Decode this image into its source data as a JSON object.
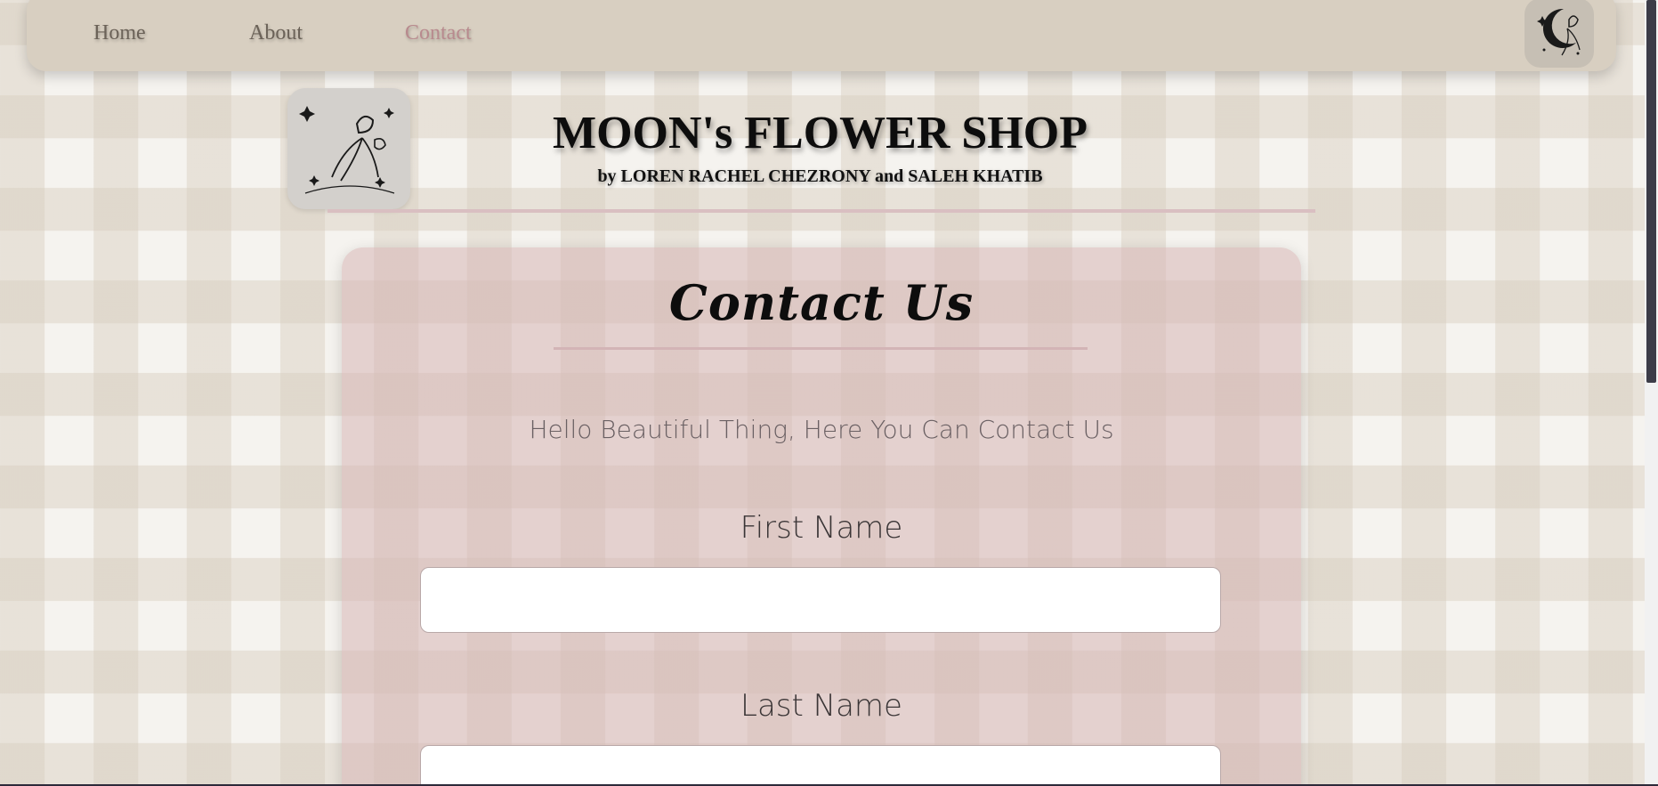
{
  "nav": {
    "items": [
      {
        "label": "Home",
        "active": false
      },
      {
        "label": "About",
        "active": false
      },
      {
        "label": "Contact",
        "active": true
      }
    ],
    "logo_icon": "moon-flower-logo-icon"
  },
  "header": {
    "title": "MOON's FLOWER SHOP",
    "subtitle": "by LOREN RACHEL CHEZRONY and SALEH KHATIB",
    "logo_icon": "moon-flower-logo-icon"
  },
  "contact": {
    "title": "Contact Us",
    "intro": "Hello Beautiful Thing, Here You Can Contact Us",
    "fields": [
      {
        "label": "First Name",
        "value": ""
      },
      {
        "label": "Last Name",
        "value": ""
      }
    ]
  },
  "colors": {
    "nav_bg": "#d8cfc1",
    "active_link": "#b88a8e",
    "card_bg": "#e0c8c8",
    "page_bg": "#f5f3ef"
  }
}
